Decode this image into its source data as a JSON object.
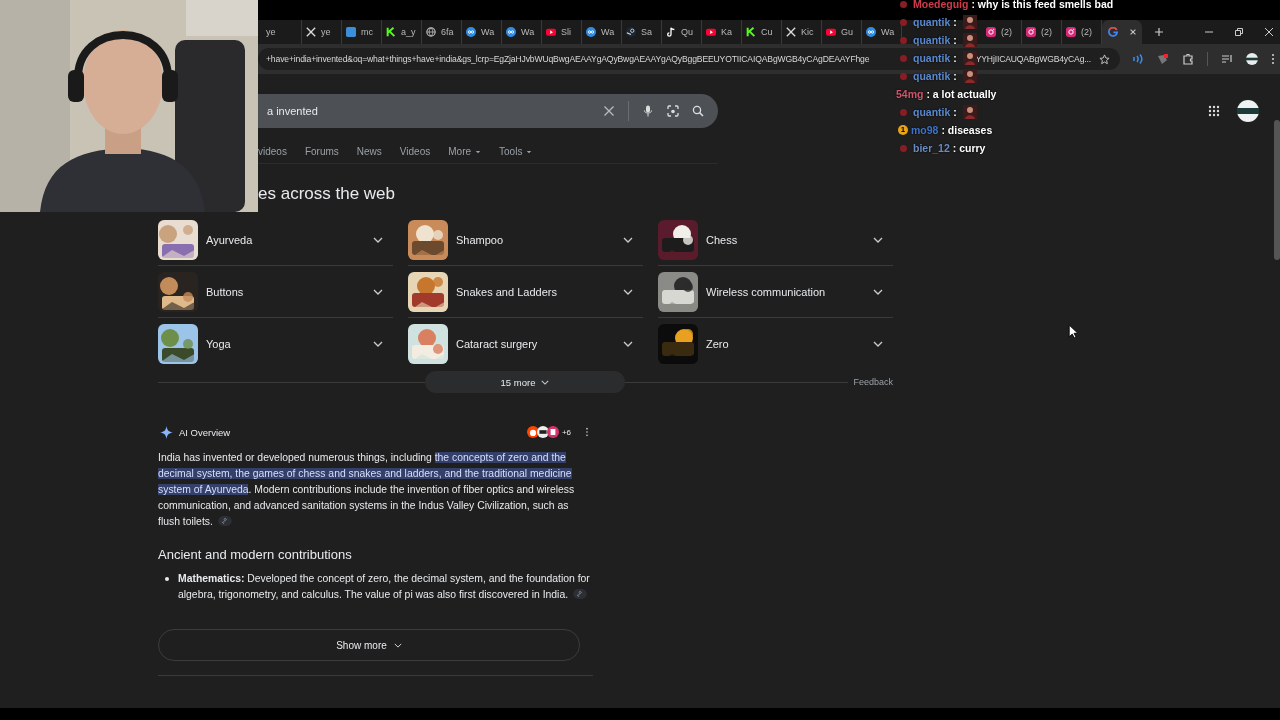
{
  "chat": [
    {
      "badge": true,
      "name": "Moedeguig",
      "color": "#d23a4a",
      "kind": "text",
      "message": ": why is this feed smells bad"
    },
    {
      "badge": true,
      "name": "quantik",
      "color": "#5b8ad0",
      "kind": "emote",
      "message": ":"
    },
    {
      "badge": true,
      "name": "quantik",
      "color": "#5b8ad0",
      "kind": "emote",
      "message": ":"
    },
    {
      "badge": true,
      "name": "quantik",
      "color": "#5b8ad0",
      "kind": "emote",
      "message": ":"
    },
    {
      "badge": true,
      "name": "quantik",
      "color": "#5b8ad0",
      "kind": "emote",
      "message": ":"
    },
    {
      "badge": false,
      "name": "54mg",
      "color": "#d0566e",
      "kind": "text",
      "message": ": a lot actually"
    },
    {
      "badge": true,
      "name": "quantik",
      "color": "#5b8ad0",
      "kind": "emote",
      "message": ":"
    },
    {
      "badge": true,
      "badge_text": "1",
      "name": "mo98",
      "color": "#3e74c8",
      "kind": "text",
      "message": ": diseases"
    },
    {
      "badge": true,
      "name": "bier_12",
      "color": "#6a8cc0",
      "kind": "text",
      "message": ": curry"
    }
  ],
  "browser": {
    "tabs": [
      {
        "kind": "plain",
        "title": "ye",
        "selected": false
      },
      {
        "kind": "x",
        "title": "ye",
        "selected": false
      },
      {
        "kind": "square",
        "title": "mc",
        "selected": false
      },
      {
        "kind": "k",
        "title": "a_y",
        "selected": false
      },
      {
        "kind": "globe",
        "title": "6fa",
        "selected": false
      },
      {
        "kind": "ring",
        "title": "Wa",
        "selected": false
      },
      {
        "kind": "ring",
        "title": "Wa",
        "selected": false
      },
      {
        "kind": "play",
        "title": "Sli",
        "selected": false
      },
      {
        "kind": "ring",
        "title": "Wa",
        "selected": false
      },
      {
        "kind": "steam",
        "title": "Sa",
        "selected": false
      },
      {
        "kind": "note",
        "title": "Qu",
        "selected": false
      },
      {
        "kind": "play",
        "title": "Ka",
        "selected": false
      },
      {
        "kind": "k",
        "title": "Cu",
        "selected": false
      },
      {
        "kind": "x",
        "title": "Kic",
        "selected": false
      },
      {
        "kind": "play",
        "title": "Gu",
        "selected": false
      },
      {
        "kind": "ring",
        "title": "Wa",
        "selected": false
      },
      {
        "kind": "gap"
      },
      {
        "kind": "camera",
        "title": "(2)",
        "selected": false
      },
      {
        "kind": "camera",
        "title": "(2)",
        "selected": false
      },
      {
        "kind": "camera",
        "title": "(2)",
        "selected": false
      },
      {
        "kind": "g",
        "selected": true
      }
    ],
    "address": [
      "+have+india+invented&oq=what+things+have+india&gs_lcrp=EgZjaHJvbWUqBwgAEAAYgAQyBwgAEAAYgAQyBggBEEUYOTIICAIQABgWGB4yCAgDEAAYFhge",
      "YYHjIICAUQABgWGB4yCAg..."
    ]
  },
  "search": {
    "value": "a invented"
  },
  "nav": [
    {
      "label": "videos",
      "dropdown": false
    },
    {
      "label": "Forums",
      "dropdown": false
    },
    {
      "label": "News",
      "dropdown": false
    },
    {
      "label": "Videos",
      "dropdown": false
    },
    {
      "label": "More",
      "dropdown": true
    },
    {
      "label": "Tools",
      "dropdown": true
    }
  ],
  "section_heading": "es across the web",
  "topics": [
    {
      "label": "Ayurveda"
    },
    {
      "label": "Shampoo"
    },
    {
      "label": "Chess"
    },
    {
      "label": "Buttons"
    },
    {
      "label": "Snakes and Ladders"
    },
    {
      "label": "Wireless communication"
    },
    {
      "label": "Yoga"
    },
    {
      "label": "Cataract surgery"
    },
    {
      "label": "Zero"
    }
  ],
  "more_button": "15 more",
  "feedback": "Feedback",
  "ai_overview": {
    "title": "AI Overview",
    "source_count": "+6",
    "paragraph": [
      {
        "text": "India has invented or developed numerous things, including ",
        "highlighted": false
      },
      {
        "text": "the concepts of zero and the decimal system, the games of chess and snakes and ladders, and the traditional medicine system of Ayurveda",
        "highlighted": true
      },
      {
        "text": ". Modern contributions include the invention of fiber optics and wireless communication, and advanced sanitation systems in the Indus Valley Civilization, such as flush toilets.",
        "highlighted": false
      }
    ],
    "heading": "Ancient and modern contributions",
    "bullets": [
      "**Mathematics:** Developed the concept of zero, the decimal system, and the foundation for algebra, trigonometry, and calculus. The value of pi was also first discovered in India."
    ],
    "show_more": "Show more"
  }
}
